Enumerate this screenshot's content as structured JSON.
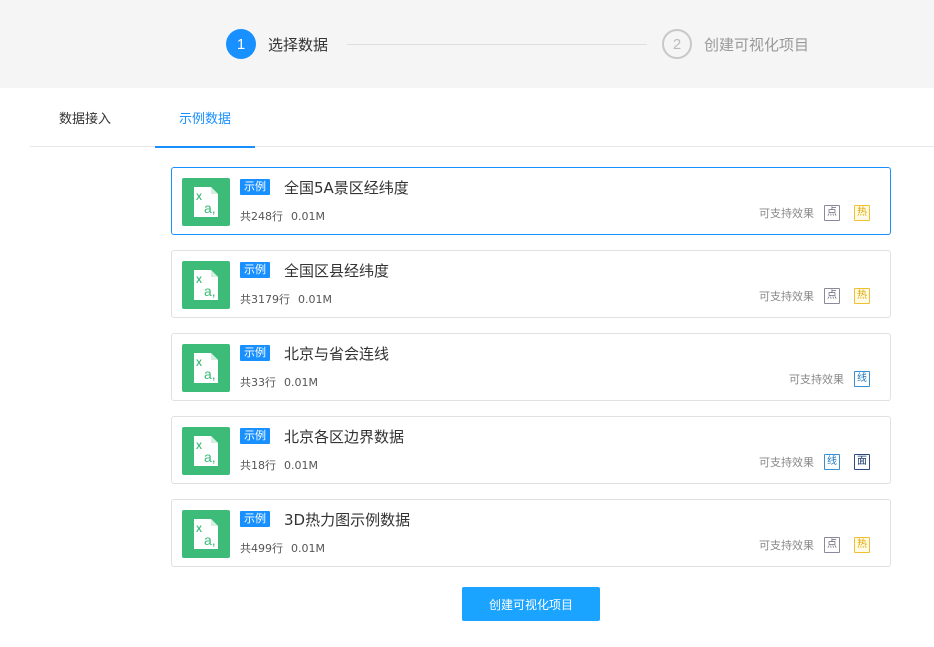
{
  "stepper": {
    "steps": [
      {
        "number": "1",
        "label": "选择数据"
      },
      {
        "number": "2",
        "label": "创建可视化项目"
      }
    ]
  },
  "tabs": [
    {
      "label": "数据接入"
    },
    {
      "label": "示例数据"
    }
  ],
  "datasets": [
    {
      "badge": "示例",
      "title": "全国5A景区经纬度",
      "rows": "共248行",
      "size": "0.01M",
      "effects_label": "可支持效果",
      "effects": [
        "点",
        "热"
      ]
    },
    {
      "badge": "示例",
      "title": "全国区县经纬度",
      "rows": "共3179行",
      "size": "0.01M",
      "effects_label": "可支持效果",
      "effects": [
        "点",
        "热"
      ]
    },
    {
      "badge": "示例",
      "title": "北京与省会连线",
      "rows": "共33行",
      "size": "0.01M",
      "effects_label": "可支持效果",
      "effects": [
        "线"
      ]
    },
    {
      "badge": "示例",
      "title": "北京各区边界数据",
      "rows": "共18行",
      "size": "0.01M",
      "effects_label": "可支持效果",
      "effects": [
        "线",
        "面"
      ]
    },
    {
      "badge": "示例",
      "title": "3D热力图示例数据",
      "rows": "共499行",
      "size": "0.01M",
      "effects_label": "可支持效果",
      "effects": [
        "点",
        "热"
      ]
    }
  ],
  "create_button": {
    "label": "创建可视化项目"
  },
  "colors": {
    "accent": "#1890ff",
    "file_icon": "#3cbc78"
  }
}
